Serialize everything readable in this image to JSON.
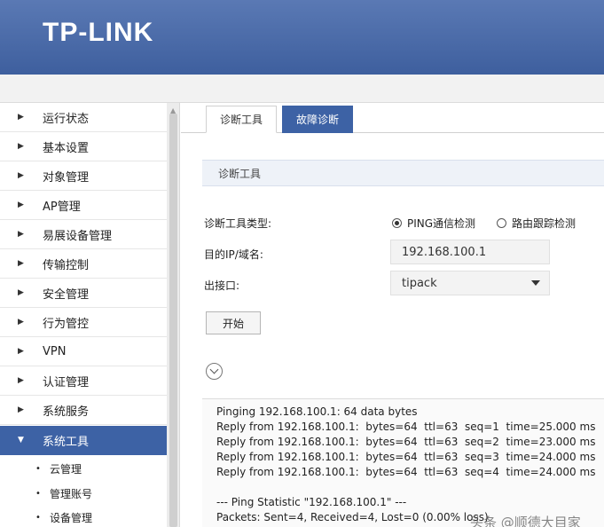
{
  "header": {
    "logo": "TP-LINK"
  },
  "sidebar": {
    "items": [
      {
        "label": "运行状态"
      },
      {
        "label": "基本设置"
      },
      {
        "label": "对象管理"
      },
      {
        "label": "AP管理"
      },
      {
        "label": "易展设备管理"
      },
      {
        "label": "传输控制"
      },
      {
        "label": "安全管理"
      },
      {
        "label": "行为管控"
      },
      {
        "label": "VPN"
      },
      {
        "label": "认证管理"
      },
      {
        "label": "系统服务"
      },
      {
        "label": "系统工具"
      }
    ],
    "active_index": 11,
    "sub_items": [
      {
        "label": "云管理"
      },
      {
        "label": "管理账号"
      },
      {
        "label": "设备管理"
      }
    ]
  },
  "tabs": [
    {
      "label": "诊断工具",
      "active": true
    },
    {
      "label": "故障诊断",
      "active": false
    }
  ],
  "section": {
    "title": "诊断工具"
  },
  "form": {
    "type_label": "诊断工具类型:",
    "options": [
      {
        "label": "PING通信检测",
        "selected": true
      },
      {
        "label": "路由跟踪检测",
        "selected": false
      }
    ],
    "target_label": "目的IP/域名:",
    "target_value": "192.168.100.1",
    "iface_label": "出接口:",
    "iface_value": "tipack",
    "start_label": "开始"
  },
  "output": {
    "lines": [
      "Pinging 192.168.100.1: 64 data bytes",
      "Reply from 192.168.100.1:  bytes=64  ttl=63  seq=1  time=25.000 ms",
      "Reply from 192.168.100.1:  bytes=64  ttl=63  seq=2  time=23.000 ms",
      "Reply from 192.168.100.1:  bytes=64  ttl=63  seq=3  time=24.000 ms",
      "Reply from 192.168.100.1:  bytes=64  ttl=63  seq=4  time=24.000 ms",
      "",
      "--- Ping Statistic \"192.168.100.1\" ---",
      "Packets: Sent=4, Received=4, Lost=0 (0.00% loss)"
    ]
  },
  "watermark": "头条 @顺德大目家"
}
